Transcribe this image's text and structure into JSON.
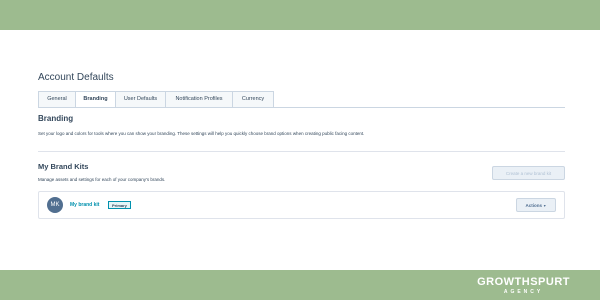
{
  "header": {
    "title": "Account Defaults"
  },
  "tabs": [
    {
      "label": "General"
    },
    {
      "label": "Branding",
      "active": true
    },
    {
      "label": "User Defaults"
    },
    {
      "label": "Notification Profiles"
    },
    {
      "label": "Currency"
    }
  ],
  "branding": {
    "title": "Branding",
    "description": "Set your logo and colors for tools where you can show your branding. These settings will help you quickly choose brand options when creating public facing content."
  },
  "brand_kits": {
    "title": "My Brand Kits",
    "description": "Manage assets and settings for each of your company's brands.",
    "create_button": "Create a new brand kit",
    "kits": [
      {
        "initials": "MK",
        "name": "My brand kit",
        "badge": "Primary",
        "actions_label": "Actions"
      }
    ]
  },
  "footer_logo": {
    "name": "GROWTHSPURT",
    "sub": "AGENCY"
  },
  "colors": {
    "band": "#9dbb8f",
    "link": "#0091ae",
    "text": "#33475b",
    "avatar": "#516f90"
  },
  "icons": {
    "actions_caret": "caret-down-icon"
  }
}
